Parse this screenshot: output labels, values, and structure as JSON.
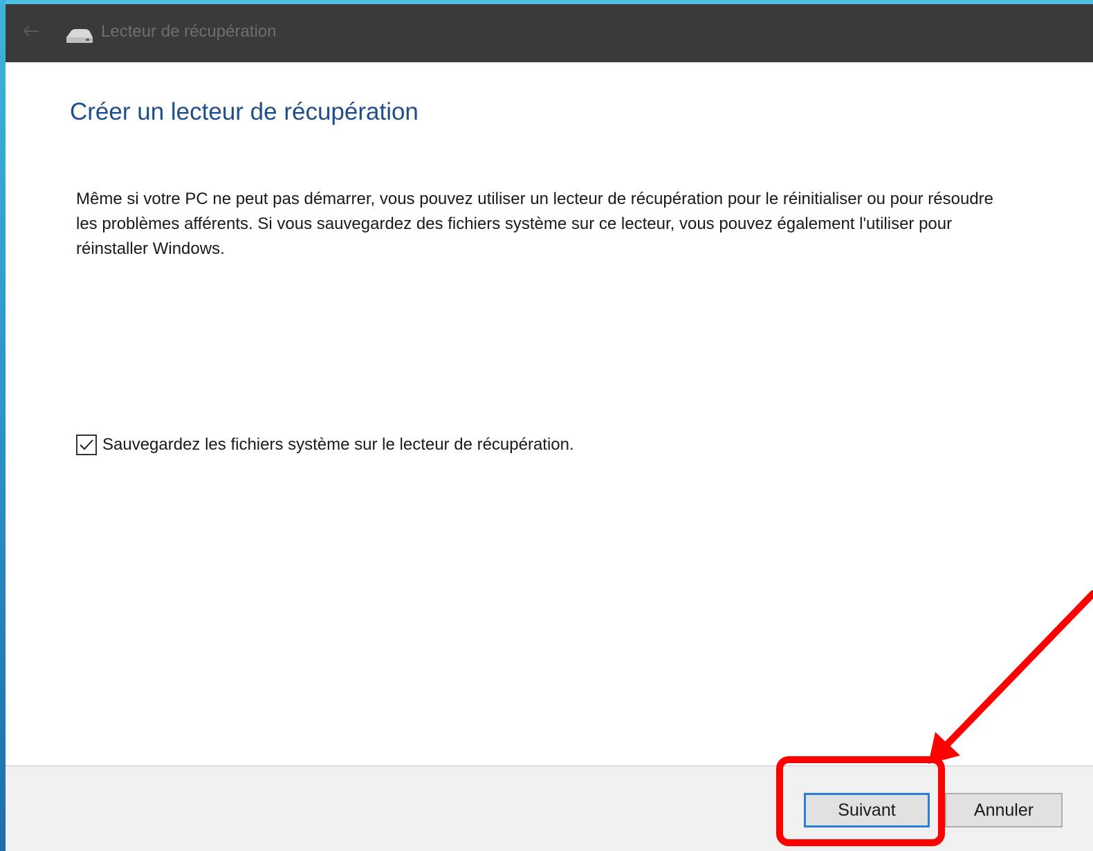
{
  "window": {
    "title": "Lecteur de récupération",
    "icons": {
      "back": "back-arrow-icon",
      "app": "drive-icon"
    }
  },
  "main": {
    "heading": "Créer un lecteur de récupération",
    "description": "Même si votre PC ne peut pas démarrer, vous pouvez utiliser un lecteur de récupération pour le réinitialiser ou pour résoudre les problèmes afférents. Si vous sauvegardez des fichiers système sur ce lecteur, vous pouvez également l'utiliser pour réinstaller Windows.",
    "checkbox": {
      "label": "Sauvegardez les fichiers système sur le lecteur de récupération.",
      "checked": true
    }
  },
  "footer": {
    "next_label": "Suivant",
    "cancel_label": "Annuler"
  },
  "annotation": {
    "color": "#ff0000"
  }
}
